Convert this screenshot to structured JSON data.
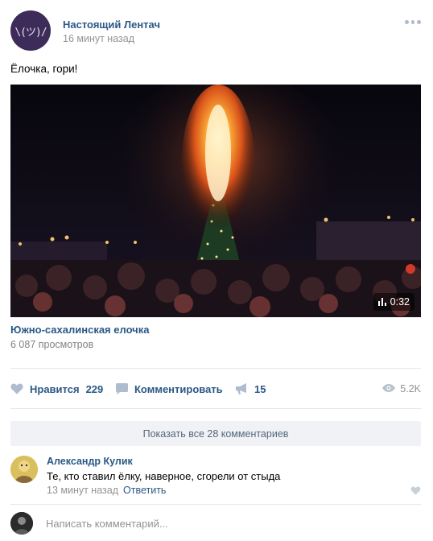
{
  "post": {
    "author": "Настоящий Лентач",
    "time": "16 минут назад",
    "avatar_glyph": "\\(ツ)/",
    "text": "Ёлочка, гори!"
  },
  "video": {
    "duration": "0:32",
    "title": "Южно-сахалинская елочка",
    "views": "6 087 просмотров"
  },
  "actions": {
    "like_label": "Нравится",
    "like_count": "229",
    "comment_label": "Комментировать",
    "share_count": "15",
    "views_count": "5.2K"
  },
  "comments": {
    "show_all": "Показать все 28 комментариев",
    "items": [
      {
        "author": "Александр Кулик",
        "text": "Те, кто ставил ёлку, наверное, сгорели от стыда",
        "time": "13 минут назад",
        "reply": "Ответить"
      }
    ],
    "placeholder": "Написать комментарий..."
  },
  "colors": {
    "link": "#2a5885",
    "muted": "#939393",
    "icon": "#aebdcd",
    "button_bg": "#f0f2f5"
  }
}
